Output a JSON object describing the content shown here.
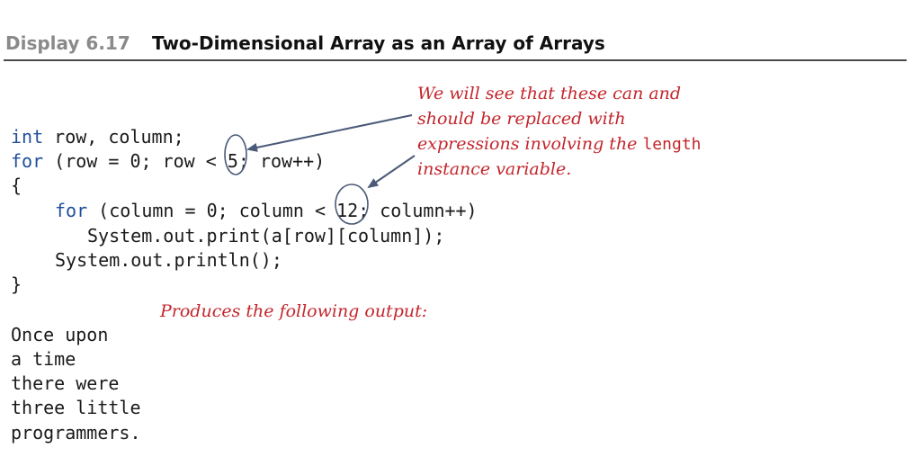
{
  "header": {
    "display_number": "Display 6.17",
    "title": "Two-Dimensional Array as an Array of Arrays"
  },
  "code": {
    "line1_kw": "int",
    "line1_rest": " row, column;",
    "line2_kw": "for",
    "line2_rest": " (row = 0; row < 5; row++)",
    "line3": "{",
    "line4_kw": "for",
    "line4_rest": " (column = 0; column < 12; column++)",
    "line5": "System.out.print(a[row][column]);",
    "line6": "System.out.println();",
    "line7": "}"
  },
  "annotation": {
    "line1": "We will see that these can and",
    "line2": "should be replaced with",
    "line3_prefix": "expressions involving the ",
    "line3_code": "length",
    "line4": "instance variable."
  },
  "output_caption": "Produces the following output:",
  "output_lines": [
    "Once upon",
    "a time",
    "there were",
    "three little",
    "programmers."
  ],
  "colors": {
    "keyword": "#1f4f9c",
    "annotation": "#c3262c",
    "arrow": "#4a5a78"
  }
}
